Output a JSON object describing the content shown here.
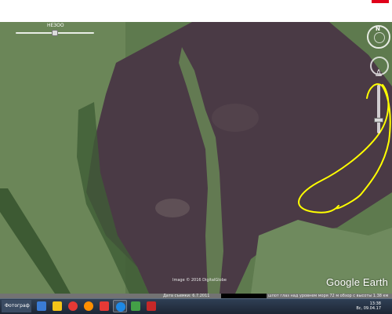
{
  "slider": {
    "label": "НЕЗОО"
  },
  "navigation": {
    "north_label": "N"
  },
  "watermark": {
    "text": "Google Earth"
  },
  "copyright": {
    "text": "Image © 2016 DigitalGlobe"
  },
  "statusbar": {
    "date_text": "Дата съемки: 6.7.2011",
    "coords_text": "шпот  глаз  над уровнем  моря  72 м   обзор с высоты  1.38 км",
    "alt_text": "1.38 км"
  },
  "taskbar": {
    "start_label": "Фотограф",
    "time": "13:38",
    "date": "Вс, 09.04.17",
    "items": [
      {
        "name": "taskbar-item-1",
        "color": "#3a7bd5"
      },
      {
        "name": "taskbar-item-2",
        "color": "#f5c518"
      },
      {
        "name": "taskbar-item-3",
        "color": "#e53935"
      },
      {
        "name": "taskbar-item-4",
        "color": "#ff8f00"
      },
      {
        "name": "taskbar-item-5",
        "color": "#e53935"
      },
      {
        "name": "taskbar-item-6",
        "color": "#1e88e5"
      },
      {
        "name": "taskbar-item-7",
        "color": "#43a047"
      },
      {
        "name": "taskbar-item-8",
        "color": "#c62828"
      }
    ]
  },
  "annotation": {
    "color": "#ffff00"
  }
}
